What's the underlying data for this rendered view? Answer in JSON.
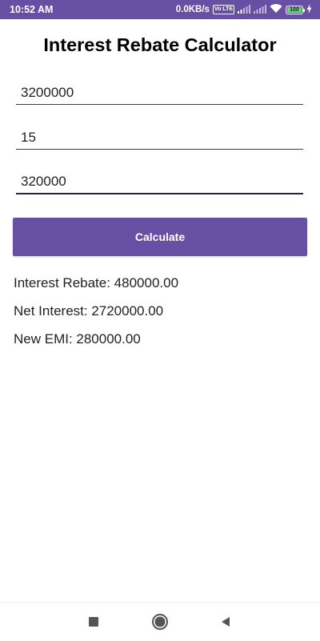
{
  "status_bar": {
    "time": "10:52 AM",
    "network_speed": "0.0KB/s",
    "volte_badge": "Vo LTE",
    "battery_level": "100"
  },
  "app": {
    "title": "Interest Rebate Calculator"
  },
  "form": {
    "principal_value": "3200000",
    "tenure_value": "15",
    "rebate_value": "320000",
    "calculate_label": "Calculate"
  },
  "results": {
    "interest_rebate": "Interest Rebate: 480000.00",
    "net_interest": "Net Interest: 2720000.00",
    "new_emi": "New EMI: 280000.00"
  },
  "colors": {
    "accent": "#6750a4",
    "battery_fill": "#5ee06b"
  },
  "icons": {
    "nav_recents": "square-recents-icon",
    "nav_home": "circle-home-icon",
    "nav_back": "triangle-back-icon"
  }
}
